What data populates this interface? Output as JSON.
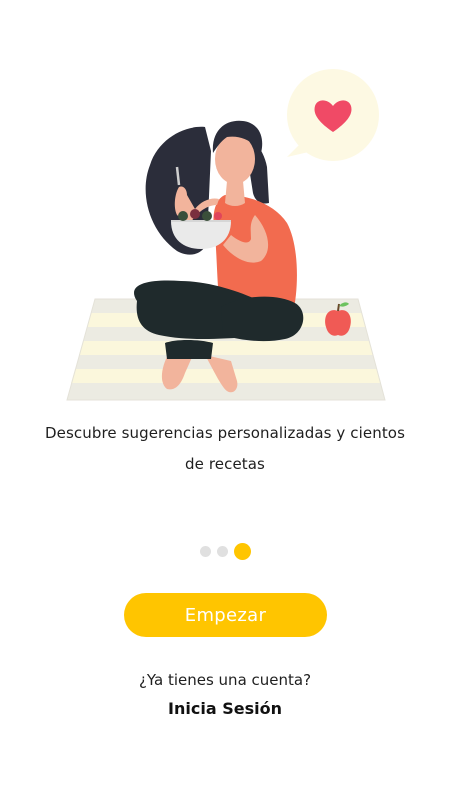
{
  "onboarding": {
    "description": "Descubre sugerencias personalizadas y cientos de recetas",
    "illustration_name": "woman-eating-salad-illustration",
    "pager": {
      "total": 3,
      "active_index": 2
    }
  },
  "actions": {
    "start_label": "Empezar",
    "account_question": "¿Ya tienes una cuenta?",
    "login_label": "Inicia Sesión"
  },
  "colors": {
    "accent": "#ffc500",
    "inactive_dot": "#e0e0e0",
    "shirt": "#f26b4f",
    "hair": "#2b2d3a",
    "pants": "#1f2a2c",
    "heart": "#f04a66"
  }
}
